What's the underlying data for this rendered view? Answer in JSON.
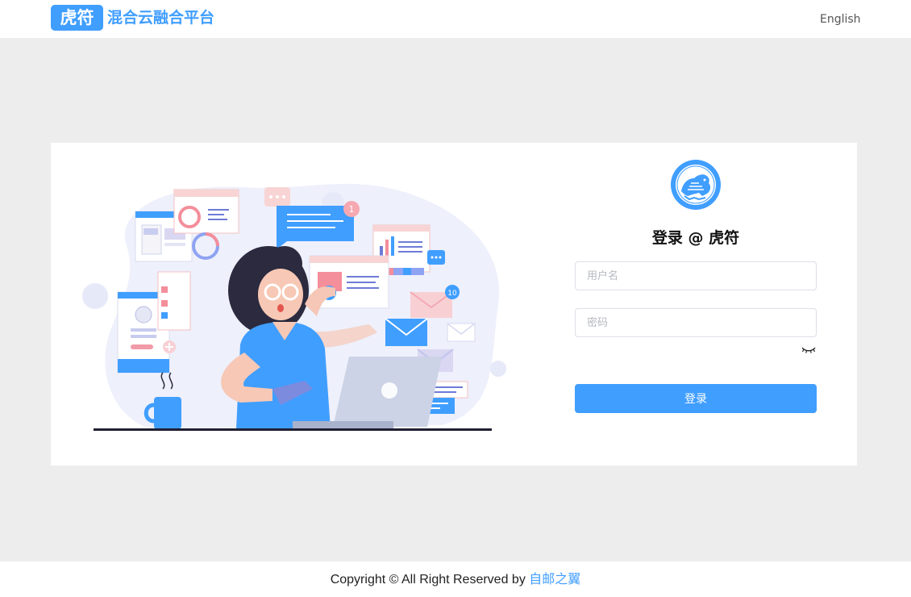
{
  "header": {
    "logo_badge": "虎符",
    "platform_title": "混合云融合平台",
    "language_link": "English"
  },
  "login": {
    "title": "登录 @ 虎符",
    "username_placeholder": "用户名",
    "password_placeholder": "密码",
    "submit_label": "登录"
  },
  "illustration": {
    "notification_count_1": "1",
    "notification_count_2": "10"
  },
  "footer": {
    "copyright_text": "Copyright © All Right Reserved by ",
    "author_link": "自邮之翼"
  },
  "colors": {
    "accent": "#409eff",
    "page_background": "#ededed"
  },
  "icons": [
    "tiger-emblem-icon",
    "eye-closed-icon"
  ]
}
